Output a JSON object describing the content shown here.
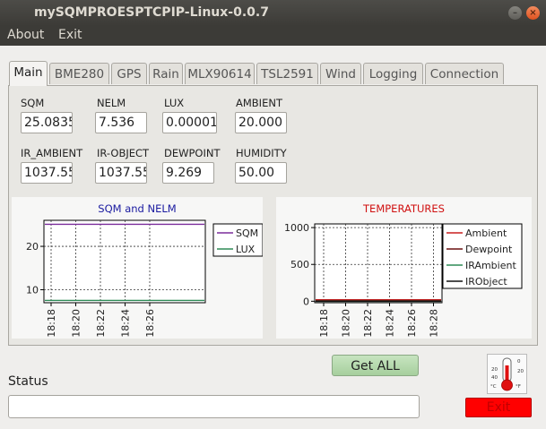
{
  "window": {
    "title": "mySQMPROESPTCPIP-Linux-0.0.7"
  },
  "menu": [
    {
      "label": "About"
    },
    {
      "label": "Exit"
    }
  ],
  "tabs": [
    {
      "label": "Main",
      "active": true
    },
    {
      "label": "BME280"
    },
    {
      "label": "GPS"
    },
    {
      "label": "Rain"
    },
    {
      "label": "MLX90614"
    },
    {
      "label": "TSL2591"
    },
    {
      "label": "Wind"
    },
    {
      "label": "Logging"
    },
    {
      "label": "Connection"
    }
  ],
  "fields": [
    {
      "label": "SQM",
      "value": "25.0835"
    },
    {
      "label": "NELM",
      "value": "7.536"
    },
    {
      "label": "LUX",
      "value": "0.00001"
    },
    {
      "label": "AMBIENT",
      "value": "20.000"
    },
    {
      "label": "IR_AMBIENT",
      "value": "1037.55"
    },
    {
      "label": "IR-OBJECT",
      "value": "1037.55"
    },
    {
      "label": "DEWPOINT",
      "value": "9.269"
    },
    {
      "label": "HUMIDITY",
      "value": "50.00"
    }
  ],
  "chart_data": [
    {
      "type": "line",
      "title": "SQM and NELM",
      "title_color": "#1a1aa0",
      "x": [
        "18:18",
        "18:20",
        "18:22",
        "18:24",
        "18:26"
      ],
      "ylim": [
        7,
        26
      ],
      "yticks": [
        10,
        20
      ],
      "grid": true,
      "legend_position": "right",
      "series": [
        {
          "name": "SQM",
          "color": "#7b2d9b",
          "values": [
            25.0835,
            25.0835,
            25.0835,
            25.0835,
            25.0835,
            25.0835
          ]
        },
        {
          "name": "LUX",
          "color": "#2e8b57",
          "values": [
            7.536,
            7.536,
            7.536,
            7.536,
            7.536,
            7.536
          ]
        }
      ]
    },
    {
      "type": "line",
      "title": "TEMPERATURES",
      "title_color": "#d01010",
      "x": [
        "18:18",
        "18:20",
        "18:22",
        "18:24",
        "18:26",
        "18:28"
      ],
      "ylim": [
        -20,
        1050
      ],
      "yticks": [
        0,
        500,
        1000
      ],
      "grid": true,
      "legend_position": "right",
      "series": [
        {
          "name": "Ambient",
          "color": "#c81e1e",
          "values": [
            20,
            20,
            20,
            20,
            20,
            20
          ]
        },
        {
          "name": "Dewpoint",
          "color": "#6a1010",
          "values": [
            9.269,
            9.269,
            9.269,
            9.269,
            9.269,
            9.269
          ]
        },
        {
          "name": "IRAmbient",
          "color": "#2e8b57",
          "values": [
            0,
            0,
            0,
            0,
            0,
            0
          ]
        },
        {
          "name": "IRObject",
          "color": "#111111",
          "values": [
            0,
            0,
            0,
            0,
            0,
            0
          ]
        }
      ]
    }
  ],
  "buttons": {
    "get_all": "Get ALL",
    "exit": "Exit"
  },
  "status": {
    "label": "Status",
    "value": ""
  },
  "thermometer": {
    "labels": [
      "0",
      "20",
      "20",
      "40",
      "°C",
      "°F"
    ]
  }
}
